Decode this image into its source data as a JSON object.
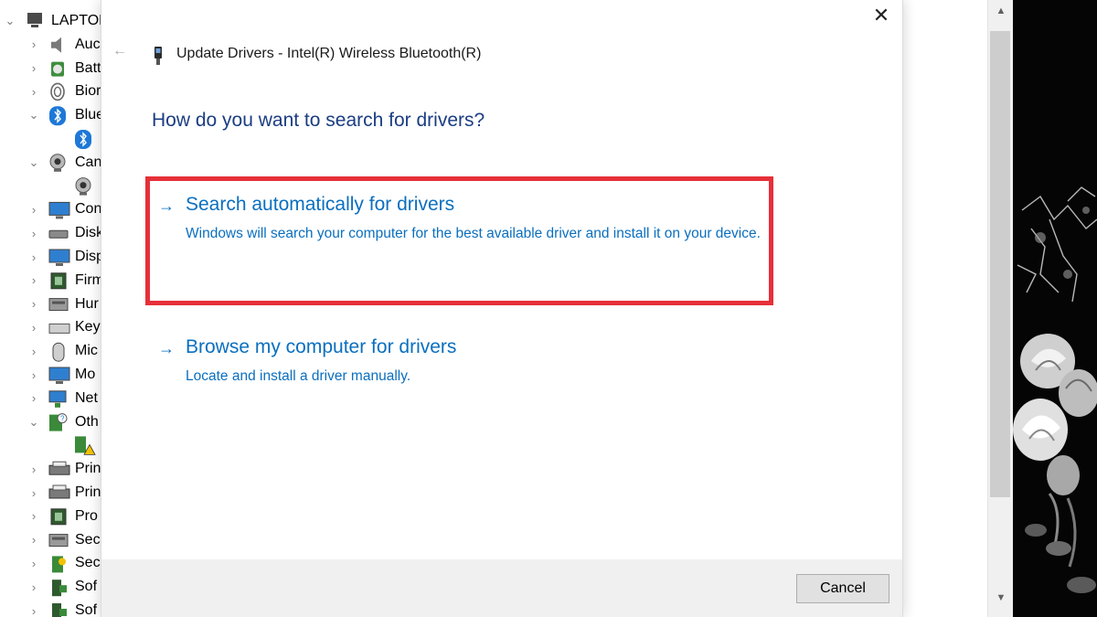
{
  "device_manager": {
    "root_label": "LAPTOP",
    "items": [
      {
        "label": "Auc",
        "expanded": false,
        "icon": "audio-icon"
      },
      {
        "label": "Batt",
        "expanded": false,
        "icon": "battery-icon"
      },
      {
        "label": "Bior",
        "expanded": false,
        "icon": "biometric-icon"
      },
      {
        "label": "Blue",
        "expanded": true,
        "icon": "bluetooth-icon"
      },
      {
        "label": "",
        "child": true,
        "icon": "bluetooth-icon"
      },
      {
        "label": "Can",
        "expanded": true,
        "icon": "camera-icon"
      },
      {
        "label": "",
        "child": true,
        "icon": "camera-icon"
      },
      {
        "label": "Con",
        "expanded": false,
        "icon": "computer-icon"
      },
      {
        "label": "Disk",
        "expanded": false,
        "icon": "disk-icon"
      },
      {
        "label": "Disp",
        "expanded": false,
        "icon": "display-icon"
      },
      {
        "label": "Firm",
        "expanded": false,
        "icon": "firmware-icon"
      },
      {
        "label": "Hur",
        "expanded": false,
        "icon": "hid-icon"
      },
      {
        "label": "Key",
        "expanded": false,
        "icon": "keyboard-icon"
      },
      {
        "label": "Mic",
        "expanded": false,
        "icon": "mouse-icon"
      },
      {
        "label": "Mo",
        "expanded": false,
        "icon": "monitor-icon"
      },
      {
        "label": "Net",
        "expanded": false,
        "icon": "network-icon"
      },
      {
        "label": "Oth",
        "expanded": true,
        "icon": "other-devices-icon"
      },
      {
        "label": "",
        "child": true,
        "icon": "warning-device-icon"
      },
      {
        "label": "Prin",
        "expanded": false,
        "icon": "print-queue-icon"
      },
      {
        "label": "Prin",
        "expanded": false,
        "icon": "printer-icon"
      },
      {
        "label": "Pro",
        "expanded": false,
        "icon": "processor-icon"
      },
      {
        "label": "Sec",
        "expanded": false,
        "icon": "security-device-icon"
      },
      {
        "label": "Sec",
        "expanded": false,
        "icon": "security-key-icon"
      },
      {
        "label": "Sof",
        "expanded": false,
        "icon": "software-component-icon"
      },
      {
        "label": "Sof",
        "expanded": false,
        "icon": "software-device-icon"
      }
    ]
  },
  "dialog": {
    "title": "Update Drivers - Intel(R) Wireless Bluetooth(R)",
    "question": "How do you want to search for drivers?",
    "options": [
      {
        "title": "Search automatically for drivers",
        "description": "Windows will search your computer for the best available driver and install it on your device.",
        "highlighted": true
      },
      {
        "title": "Browse my computer for drivers",
        "description": "Locate and install a driver manually.",
        "highlighted": false
      }
    ],
    "cancel_label": "Cancel",
    "close_glyph": "✕",
    "back_glyph": "←",
    "arrow_glyph": "→"
  },
  "colors": {
    "link_blue": "#0a6fbf",
    "heading_blue": "#1b3d82",
    "highlight_red": "#e63039",
    "footer_gray": "#f0f0f0"
  }
}
